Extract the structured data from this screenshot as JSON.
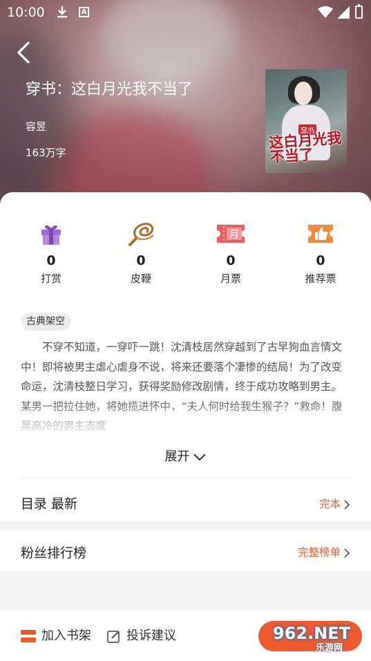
{
  "status_bar": {
    "time": "10:00"
  },
  "book": {
    "title": "穿书：这白月光我不当了",
    "author": "容昱",
    "word_count": "163万字",
    "cover_text": "这白月光我不当了",
    "cover_tag": "穿书"
  },
  "stats": [
    {
      "icon": "gift-icon",
      "count": "0",
      "label": "打赏"
    },
    {
      "icon": "whip-icon",
      "count": "0",
      "label": "皮鞭"
    },
    {
      "icon": "monthly-ticket-icon",
      "count": "0",
      "label": "月票",
      "icon_text": "月"
    },
    {
      "icon": "thumbs-up-ticket-icon",
      "count": "0",
      "label": "推荐票"
    }
  ],
  "tag": "古典架空",
  "description": "不穿不知道，一穿吓一跳！沈清枝居然穿越到了古早狗血言情文中！即将被男主虐心虐身不说，将来还要落个凄惨的结局！为了改变命运，沈清枝整日学习，获得奖励修改剧情，终于成功攻略到男主。某男一把拉住她，将她揽进怀中，“夫人何时给我生猴子？”救命！腹黑高冷的男主态度",
  "expand_label": "展开",
  "catalog": {
    "label": "目录 最新",
    "status": "完本"
  },
  "fans": {
    "label": "粉丝排行榜",
    "link": "完整榜单"
  },
  "bottom_bar": {
    "shelf": "加入书架",
    "feedback": "投诉建议"
  },
  "watermark": {
    "text": "962.NET",
    "sub": "乐游网"
  },
  "colors": {
    "accent": "#ef5b2f",
    "purple": "#a26ad6",
    "brown": "#a86a2d",
    "red": "#ef5b5b",
    "orange": "#f08a3c"
  }
}
